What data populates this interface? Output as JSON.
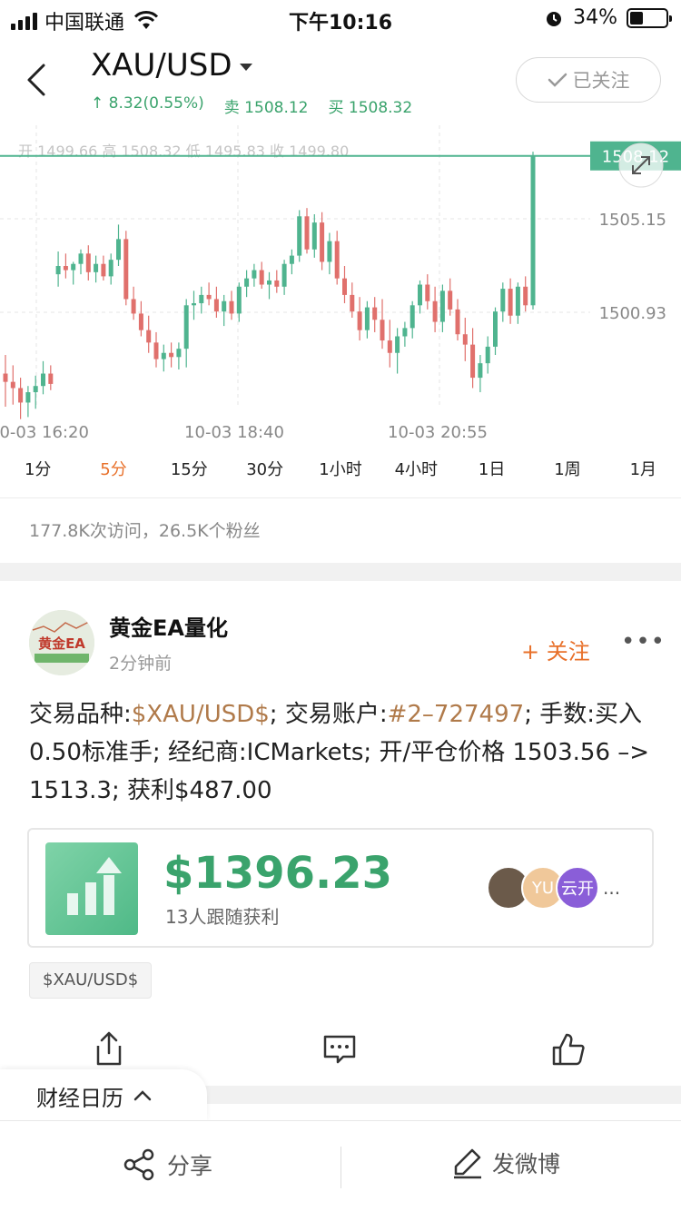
{
  "status_bar": {
    "carrier": "中国联通",
    "time": "下午10:16",
    "battery": "34%",
    "battery_level": 0.34
  },
  "header": {
    "symbol": "XAU/USD",
    "change": "↑ 8.32(0.55%)",
    "sell": "卖 1508.12",
    "buy": "买 1508.32",
    "follow_label": "已关注"
  },
  "chart": {
    "ohlc_label": "开 1499.66  高 1508.32  低 1495.83  收 1499.80",
    "current_price": "1508.12",
    "price_levels": [
      "1505.15",
      "1500.93"
    ],
    "time_labels": [
      "10-03 16:20",
      "10-03 18:40",
      "10-03 20:55"
    ],
    "colors": {
      "up": "#4fb48f",
      "down": "#e0706c",
      "price_line": "#4fb48f"
    }
  },
  "chart_data": {
    "type": "candlestick",
    "series": [
      {
        "o": 1497.6,
        "h": 1498.5,
        "l": 1496.0,
        "c": 1497.2
      },
      {
        "o": 1497.2,
        "h": 1498.0,
        "l": 1496.1,
        "c": 1496.9
      },
      {
        "o": 1496.9,
        "h": 1497.4,
        "l": 1495.4,
        "c": 1496.2
      },
      {
        "o": 1496.2,
        "h": 1497.0,
        "l": 1495.5,
        "c": 1496.7
      },
      {
        "o": 1496.7,
        "h": 1497.5,
        "l": 1495.9,
        "c": 1497.0
      },
      {
        "o": 1497.0,
        "h": 1498.2,
        "l": 1496.6,
        "c": 1497.6
      },
      {
        "o": 1497.6,
        "h": 1498.0,
        "l": 1496.8,
        "c": 1497.1
      },
      {
        "o": 1502.4,
        "h": 1503.5,
        "l": 1501.8,
        "c": 1502.8
      },
      {
        "o": 1502.8,
        "h": 1503.4,
        "l": 1502.2,
        "c": 1502.6
      },
      {
        "o": 1502.6,
        "h": 1503.0,
        "l": 1501.9,
        "c": 1502.9
      },
      {
        "o": 1502.9,
        "h": 1503.6,
        "l": 1502.4,
        "c": 1503.4
      },
      {
        "o": 1503.4,
        "h": 1503.8,
        "l": 1502.1,
        "c": 1502.5
      },
      {
        "o": 1502.5,
        "h": 1503.3,
        "l": 1502.0,
        "c": 1502.9
      },
      {
        "o": 1502.9,
        "h": 1503.3,
        "l": 1502.1,
        "c": 1502.3
      },
      {
        "o": 1502.3,
        "h": 1503.4,
        "l": 1501.9,
        "c": 1503.1
      },
      {
        "o": 1503.1,
        "h": 1504.8,
        "l": 1502.8,
        "c": 1504.1
      },
      {
        "o": 1504.1,
        "h": 1504.5,
        "l": 1500.9,
        "c": 1501.2
      },
      {
        "o": 1501.2,
        "h": 1501.8,
        "l": 1500.2,
        "c": 1500.5
      },
      {
        "o": 1500.5,
        "h": 1501.1,
        "l": 1499.4,
        "c": 1499.7
      },
      {
        "o": 1499.7,
        "h": 1500.4,
        "l": 1498.6,
        "c": 1499.1
      },
      {
        "o": 1499.1,
        "h": 1499.6,
        "l": 1497.9,
        "c": 1498.3
      },
      {
        "o": 1498.3,
        "h": 1499.0,
        "l": 1497.7,
        "c": 1498.6
      },
      {
        "o": 1498.6,
        "h": 1499.1,
        "l": 1497.9,
        "c": 1498.4
      },
      {
        "o": 1498.4,
        "h": 1499.1,
        "l": 1497.8,
        "c": 1498.8
      },
      {
        "o": 1498.8,
        "h": 1501.2,
        "l": 1497.9,
        "c": 1500.9
      },
      {
        "o": 1500.9,
        "h": 1501.6,
        "l": 1500.2,
        "c": 1501.0
      },
      {
        "o": 1501.0,
        "h": 1501.8,
        "l": 1500.5,
        "c": 1501.4
      },
      {
        "o": 1501.4,
        "h": 1502.0,
        "l": 1500.9,
        "c": 1501.2
      },
      {
        "o": 1501.2,
        "h": 1501.8,
        "l": 1500.3,
        "c": 1500.6
      },
      {
        "o": 1500.6,
        "h": 1501.4,
        "l": 1499.9,
        "c": 1501.1
      },
      {
        "o": 1501.1,
        "h": 1501.6,
        "l": 1500.2,
        "c": 1500.5
      },
      {
        "o": 1500.5,
        "h": 1502.0,
        "l": 1500.1,
        "c": 1501.8
      },
      {
        "o": 1501.8,
        "h": 1502.6,
        "l": 1501.3,
        "c": 1502.2
      },
      {
        "o": 1502.2,
        "h": 1502.9,
        "l": 1501.8,
        "c": 1502.6
      },
      {
        "o": 1502.6,
        "h": 1503.0,
        "l": 1501.7,
        "c": 1501.9
      },
      {
        "o": 1501.9,
        "h": 1502.5,
        "l": 1501.2,
        "c": 1502.1
      },
      {
        "o": 1502.1,
        "h": 1502.6,
        "l": 1501.5,
        "c": 1501.8
      },
      {
        "o": 1501.8,
        "h": 1503.1,
        "l": 1501.4,
        "c": 1502.9
      },
      {
        "o": 1502.9,
        "h": 1503.6,
        "l": 1502.4,
        "c": 1503.3
      },
      {
        "o": 1503.3,
        "h": 1505.5,
        "l": 1503.0,
        "c": 1505.2
      },
      {
        "o": 1505.2,
        "h": 1505.6,
        "l": 1503.4,
        "c": 1503.6
      },
      {
        "o": 1503.6,
        "h": 1505.3,
        "l": 1503.2,
        "c": 1504.9
      },
      {
        "o": 1504.9,
        "h": 1505.4,
        "l": 1502.6,
        "c": 1503.0
      },
      {
        "o": 1503.0,
        "h": 1504.4,
        "l": 1502.4,
        "c": 1504.0
      },
      {
        "o": 1504.0,
        "h": 1504.5,
        "l": 1501.9,
        "c": 1502.2
      },
      {
        "o": 1502.2,
        "h": 1502.8,
        "l": 1501.0,
        "c": 1501.4
      },
      {
        "o": 1501.4,
        "h": 1502.0,
        "l": 1500.3,
        "c": 1500.6
      },
      {
        "o": 1500.6,
        "h": 1501.3,
        "l": 1499.2,
        "c": 1499.7
      },
      {
        "o": 1499.7,
        "h": 1501.1,
        "l": 1499.3,
        "c": 1500.8
      },
      {
        "o": 1500.8,
        "h": 1501.3,
        "l": 1499.6,
        "c": 1500.2
      },
      {
        "o": 1500.2,
        "h": 1501.2,
        "l": 1498.8,
        "c": 1499.2
      },
      {
        "o": 1499.2,
        "h": 1500.2,
        "l": 1497.9,
        "c": 1498.6
      },
      {
        "o": 1498.6,
        "h": 1499.8,
        "l": 1497.6,
        "c": 1499.4
      },
      {
        "o": 1499.4,
        "h": 1500.1,
        "l": 1498.9,
        "c": 1499.8
      },
      {
        "o": 1499.8,
        "h": 1501.1,
        "l": 1499.3,
        "c": 1500.9
      },
      {
        "o": 1500.9,
        "h": 1502.1,
        "l": 1500.5,
        "c": 1501.9
      },
      {
        "o": 1501.9,
        "h": 1502.4,
        "l": 1500.7,
        "c": 1501.1
      },
      {
        "o": 1501.1,
        "h": 1501.8,
        "l": 1499.6,
        "c": 1500.1
      },
      {
        "o": 1500.1,
        "h": 1501.9,
        "l": 1499.6,
        "c": 1501.6
      },
      {
        "o": 1501.6,
        "h": 1502.2,
        "l": 1500.4,
        "c": 1500.7
      },
      {
        "o": 1500.7,
        "h": 1501.2,
        "l": 1499.2,
        "c": 1499.5
      },
      {
        "o": 1499.5,
        "h": 1500.3,
        "l": 1498.2,
        "c": 1499.0
      },
      {
        "o": 1499.0,
        "h": 1499.8,
        "l": 1496.9,
        "c": 1497.4
      },
      {
        "o": 1497.4,
        "h": 1498.5,
        "l": 1496.7,
        "c": 1498.1
      },
      {
        "o": 1498.1,
        "h": 1499.4,
        "l": 1497.6,
        "c": 1498.9
      },
      {
        "o": 1498.9,
        "h": 1500.8,
        "l": 1498.5,
        "c": 1500.6
      },
      {
        "o": 1500.6,
        "h": 1502.0,
        "l": 1500.1,
        "c": 1501.7
      },
      {
        "o": 1501.7,
        "h": 1502.2,
        "l": 1500.0,
        "c": 1500.4
      },
      {
        "o": 1500.4,
        "h": 1502.0,
        "l": 1500.0,
        "c": 1501.8
      },
      {
        "o": 1501.8,
        "h": 1502.3,
        "l": 1500.6,
        "c": 1500.9
      },
      {
        "o": 1500.9,
        "h": 1508.32,
        "l": 1500.7,
        "c": 1508.12
      }
    ],
    "ylim": [
      1496.0,
      1509.6
    ],
    "x_labels": [
      "10-03 16:20",
      "10-03 18:40",
      "10-03 20:55"
    ],
    "y_labels": [
      "1505.15",
      "1500.93"
    ]
  },
  "periods": [
    "1分",
    "5分",
    "15分",
    "30分",
    "1小时",
    "4小时",
    "1日",
    "1周",
    "1月"
  ],
  "active_period": "5分",
  "stats": "177.8K次访问，26.5K个粉丝",
  "post": {
    "avatar_text": "黄金EA",
    "author": "黄金EA量化",
    "time": "2分钟前",
    "follow_label": "+ 关注",
    "more_label": "•••",
    "body": {
      "p1": "交易品种:",
      "symbol_tag": "$XAU/USD$",
      "p2": "; 交易账户:",
      "account_tag": "#2–727497",
      "p3": "; 手数:买入 0.50标准手; 经纪商:ICMarkets; 开/平仓价格 1503.56 –> 1513.3; 获利$487.00"
    },
    "profit_amount": "$1396.23",
    "profit_sub": "13人跟随获利",
    "followers": [
      "",
      "YU",
      "云开"
    ],
    "followers_more": "...",
    "tag": "$XAU/USD$"
  },
  "calendar_tab": "财经日历",
  "bottom_bar": {
    "share": "分享",
    "post_weibo": "发微博"
  }
}
